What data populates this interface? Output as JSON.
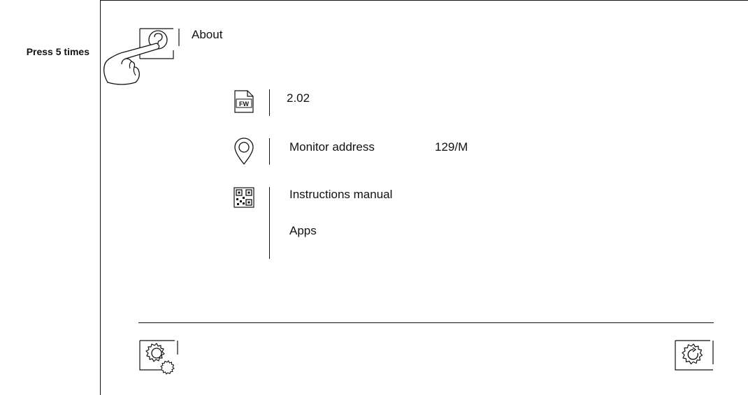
{
  "instruction": {
    "caption": "Press 5 times"
  },
  "header": {
    "title": "About"
  },
  "info": {
    "firmware": {
      "icon": "fw-icon",
      "icon_text": "FW",
      "value": "2.02"
    },
    "address": {
      "icon": "location-pin-icon",
      "label": "Monitor address",
      "value": "129/M"
    },
    "links": {
      "icon": "qr-code-icon",
      "items": [
        "Instructions manual",
        "Apps"
      ]
    }
  },
  "footer": {
    "left_icon": "settings-gears-icon",
    "right_icon": "settings-refresh-icon"
  }
}
